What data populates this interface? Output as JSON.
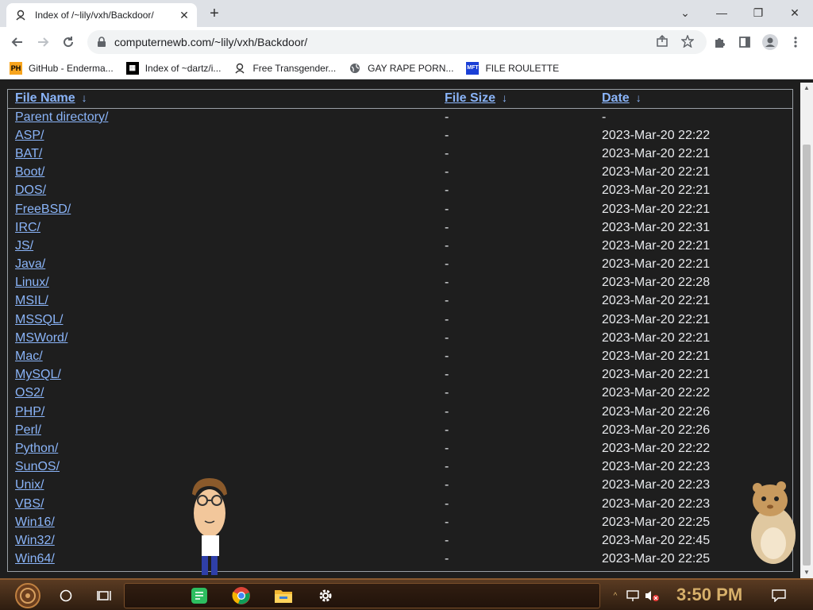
{
  "browser": {
    "tab_title": "Index of /~lily/vxh/Backdoor/",
    "url": "computernewb.com/~lily/vxh/Backdoor/"
  },
  "bookmarks": [
    {
      "label": "GitHub - Enderma...",
      "icon": "ph-icon"
    },
    {
      "label": "Index of ~dartz/i...",
      "icon": "dartz-icon"
    },
    {
      "label": "Free Transgender...",
      "icon": "spy-icon"
    },
    {
      "label": "GAY RAPE PORN...",
      "icon": "globe-icon"
    },
    {
      "label": "FILE ROULETTE",
      "icon": "mft-icon"
    }
  ],
  "listing": {
    "headers": {
      "name": "File Name",
      "size": "File Size",
      "date": "Date",
      "sort_glyph": "↓"
    },
    "rows": [
      {
        "name": "Parent directory/",
        "size": "-",
        "date": "-"
      },
      {
        "name": "ASP/",
        "size": "-",
        "date": "2023-Mar-20 22:22"
      },
      {
        "name": "BAT/",
        "size": "-",
        "date": "2023-Mar-20 22:21"
      },
      {
        "name": "Boot/",
        "size": "-",
        "date": "2023-Mar-20 22:21"
      },
      {
        "name": "DOS/",
        "size": "-",
        "date": "2023-Mar-20 22:21"
      },
      {
        "name": "FreeBSD/",
        "size": "-",
        "date": "2023-Mar-20 22:21"
      },
      {
        "name": "IRC/",
        "size": "-",
        "date": "2023-Mar-20 22:31"
      },
      {
        "name": "JS/",
        "size": "-",
        "date": "2023-Mar-20 22:21"
      },
      {
        "name": "Java/",
        "size": "-",
        "date": "2023-Mar-20 22:21"
      },
      {
        "name": "Linux/",
        "size": "-",
        "date": "2023-Mar-20 22:28"
      },
      {
        "name": "MSIL/",
        "size": "-",
        "date": "2023-Mar-20 22:21"
      },
      {
        "name": "MSSQL/",
        "size": "-",
        "date": "2023-Mar-20 22:21"
      },
      {
        "name": "MSWord/",
        "size": "-",
        "date": "2023-Mar-20 22:21"
      },
      {
        "name": "Mac/",
        "size": "-",
        "date": "2023-Mar-20 22:21"
      },
      {
        "name": "MySQL/",
        "size": "-",
        "date": "2023-Mar-20 22:21"
      },
      {
        "name": "OS2/",
        "size": "-",
        "date": "2023-Mar-20 22:22"
      },
      {
        "name": "PHP/",
        "size": "-",
        "date": "2023-Mar-20 22:26"
      },
      {
        "name": "Perl/",
        "size": "-",
        "date": "2023-Mar-20 22:26"
      },
      {
        "name": "Python/",
        "size": "-",
        "date": "2023-Mar-20 22:22"
      },
      {
        "name": "SunOS/",
        "size": "-",
        "date": "2023-Mar-20 22:23"
      },
      {
        "name": "Unix/",
        "size": "-",
        "date": "2023-Mar-20 22:23"
      },
      {
        "name": "VBS/",
        "size": "-",
        "date": "2023-Mar-20 22:23"
      },
      {
        "name": "Win16/",
        "size": "-",
        "date": "2023-Mar-20 22:25"
      },
      {
        "name": "Win32/",
        "size": "-",
        "date": "2023-Mar-20 22:45"
      },
      {
        "name": "Win64/",
        "size": "-",
        "date": "2023-Mar-20 22:25"
      }
    ]
  },
  "taskbar": {
    "clock": "3:50 PM",
    "apps": [
      "start-button",
      "search-button",
      "task-view-button",
      "notes-app-icon",
      "chrome-icon",
      "file-explorer-icon",
      "settings-icon"
    ]
  },
  "colors": {
    "link": "#8ab4f8",
    "page_bg": "#1e1e1e",
    "text": "#e8eaed",
    "clock": "#d7b06a"
  }
}
